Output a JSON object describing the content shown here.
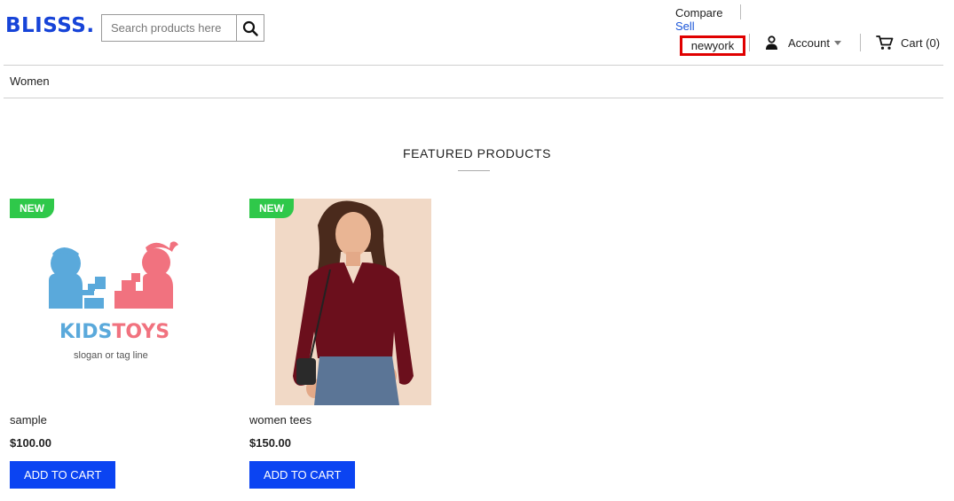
{
  "header": {
    "logo": "BLISSS.",
    "search": {
      "placeholder": "Search products here",
      "value": ""
    },
    "links": {
      "compare": "Compare",
      "sell": "Sell"
    },
    "shop": "newyork",
    "account": "Account",
    "cart": "Cart (0)"
  },
  "nav": {
    "items": [
      {
        "label": "Women"
      }
    ]
  },
  "featured": {
    "title": "FEATURED PRODUCTS",
    "products": [
      {
        "badge": "NEW",
        "name": "sample",
        "price": "$100.00",
        "button": "ADD TO CART",
        "logo": {
          "word_a": "KIDS",
          "word_b": "TOYS",
          "slogan": "slogan or tag line"
        }
      },
      {
        "badge": "NEW",
        "name": "women tees",
        "price": "$150.00",
        "button": "ADD TO CART"
      }
    ]
  },
  "colors": {
    "brand": "#1744d8",
    "button": "#0b44f2",
    "badge": "#2fc84a",
    "highlight": "#e00000",
    "kids_blue": "#5aa9db",
    "kids_pink": "#f1727f"
  }
}
